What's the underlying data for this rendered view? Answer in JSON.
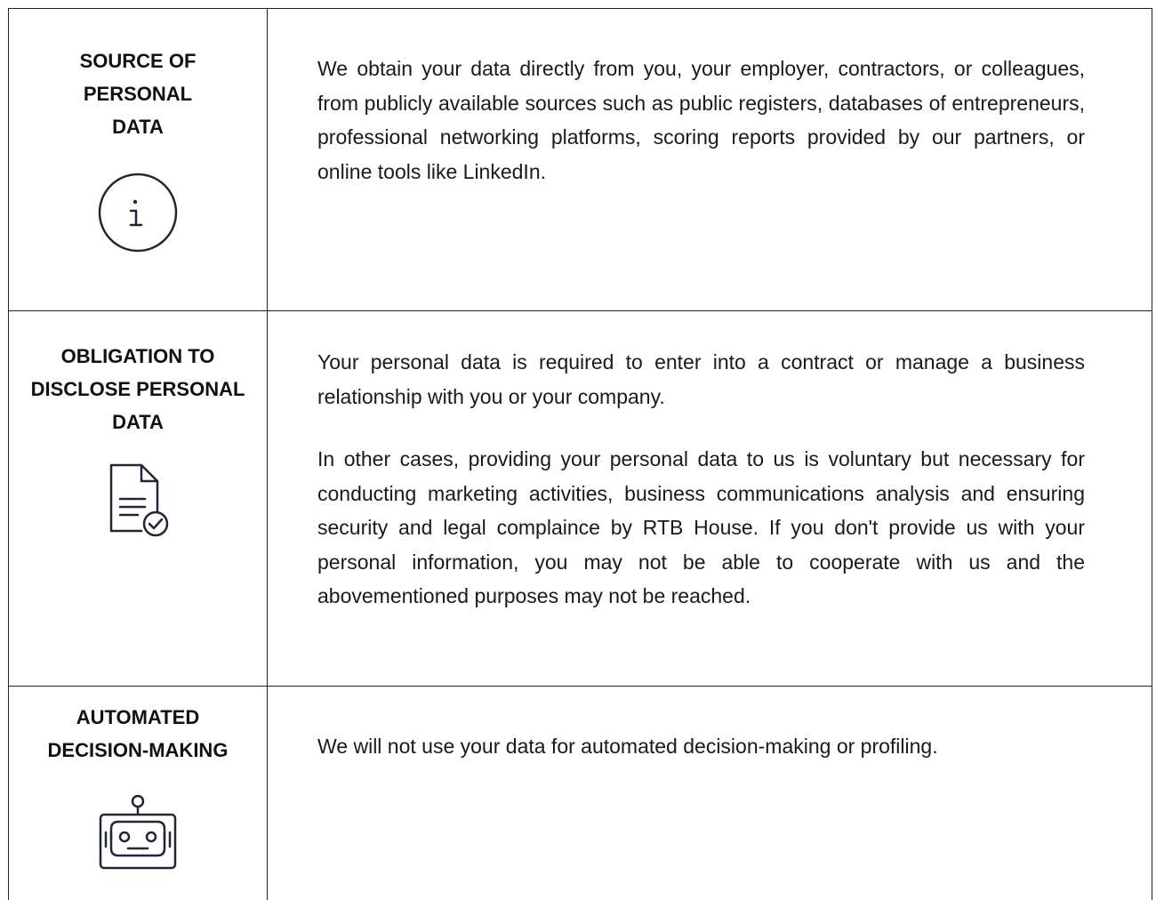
{
  "rows": [
    {
      "label": [
        "SOURCE OF",
        "PERSONAL",
        "DATA"
      ],
      "icon": "info-circle-icon",
      "paragraphs": [
        "We obtain your data directly from you, your employer, contractors, or colleagues,  from publicly available sources such as public registers, databases of entrepreneurs, professional networking platforms, scoring reports provided by our partners, or online tools like LinkedIn."
      ]
    },
    {
      "label": [
        "OBLIGATION TO",
        "DISCLOSE PERSONAL",
        "DATA"
      ],
      "icon": "document-check-icon",
      "paragraphs": [
        "Your personal data is required to enter into a contract or manage a business relationship with you or your company.",
        "In other cases, providing your personal data to us is voluntary but necessary for conducting marketing activities, business communications analysis and ensuring security and legal complaince by RTB House. If you don't provide us with your personal information, you may not be able to cooperate with us and the abovementioned purposes may not be reached."
      ]
    },
    {
      "label": [
        "AUTOMATED",
        "DECISION-MAKING"
      ],
      "icon": "robot-icon",
      "paragraphs": [
        "We will not use your data for automated decision-making or profiling."
      ]
    }
  ]
}
